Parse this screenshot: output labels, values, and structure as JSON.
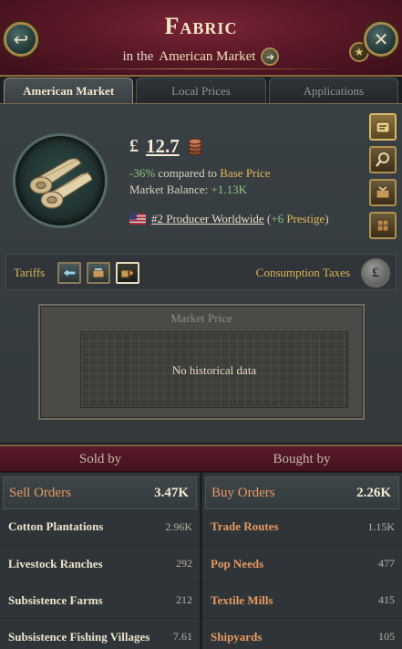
{
  "header": {
    "title": "Fabric",
    "subtitle_prefix": "in the",
    "market_name": "American Market"
  },
  "tabs": [
    {
      "label": "American Market",
      "active": true
    },
    {
      "label": "Local Prices",
      "active": false
    },
    {
      "label": "Applications",
      "active": false
    }
  ],
  "goods": {
    "icon": "fabric-rolls-icon",
    "currency_symbol": "£",
    "price": "12.7",
    "price_change": "-36%",
    "compared_text": "compared to",
    "base_price_label": "Base Price",
    "market_balance_label": "Market Balance:",
    "market_balance_value": "+1.13K",
    "producer_rank": "#2 Producer Worldwide",
    "prestige_value": "+6",
    "prestige_label": "Prestige"
  },
  "side_buttons": [
    "goods-gold-icon",
    "magnify-icon",
    "trade-icon",
    "storage-icon"
  ],
  "tariffs": {
    "label": "Tariffs",
    "buttons": [
      "import-priority-icon",
      "no-tariff-icon",
      "export-priority-icon"
    ],
    "consumption_label": "Consumption Taxes",
    "consumption_icon": "£"
  },
  "market_price_chart": {
    "title": "Market Price",
    "empty_text": "No historical data"
  },
  "sold_by": {
    "title": "Sold by",
    "header_label": "Sell Orders",
    "total": "3.47K",
    "rows": [
      {
        "name": "Cotton Plantations",
        "value": "2.96K"
      },
      {
        "name": "Livestock Ranches",
        "value": "292"
      },
      {
        "name": "Subsistence Farms",
        "value": "212"
      },
      {
        "name": "Subsistence Fishing Villages",
        "value": "7.61"
      }
    ]
  },
  "bought_by": {
    "title": "Bought by",
    "header_label": "Buy Orders",
    "total": "2.26K",
    "rows": [
      {
        "name": "Trade Routes",
        "value": "1.15K"
      },
      {
        "name": "Pop Needs",
        "value": "477"
      },
      {
        "name": "Textile Mills",
        "value": "415"
      },
      {
        "name": "Shipyards",
        "value": "105"
      }
    ]
  },
  "colors": {
    "header_bg": "#5a1827",
    "panel_bg": "#394044",
    "accent_gold": "#e2b65a",
    "positive_green": "#8bc77a",
    "order_orange": "#e89a62"
  }
}
